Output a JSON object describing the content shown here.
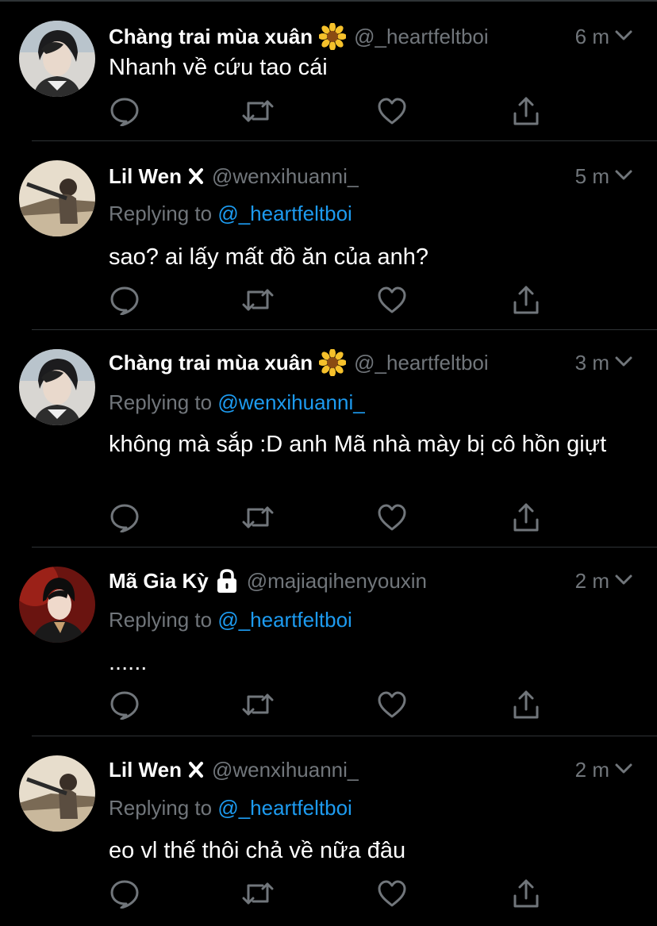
{
  "theme": {
    "background": "#000000",
    "text": "#ffffff",
    "muted": "#71767b",
    "accent": "#1d9bf0",
    "divider": "#2f3336"
  },
  "tweets": [
    {
      "name": "Chàng trai mùa xuân",
      "badge_icon": "sunflower-icon",
      "handle": "@_heartfeltboi",
      "time": "6 m",
      "reply_prefix": "",
      "reply_to": "",
      "text": "Nhanh về cứu tao cái"
    },
    {
      "name": "Lil Wen",
      "badge_icon": "x-mark-icon",
      "handle": "@wenxihuanni_",
      "time": "5 m",
      "reply_prefix": "Replying to ",
      "reply_to": "@_heartfeltboi",
      "text": "sao? ai lấy mất đồ ăn của anh?"
    },
    {
      "name": "Chàng trai mùa xuân",
      "badge_icon": "sunflower-icon",
      "handle": "@_heartfeltboi",
      "time": "3 m",
      "reply_prefix": "Replying to ",
      "reply_to": "@wenxihuanni_",
      "text": "không mà sắp :D anh Mã nhà mày bị cô hồn giựt"
    },
    {
      "name": "Mã Gia Kỳ",
      "badge_icon": "lock-icon",
      "handle": "@majiaqihenyouxin",
      "time": "2 m",
      "reply_prefix": "Replying to ",
      "reply_to": "@_heartfeltboi",
      "text": "......"
    },
    {
      "name": "Lil Wen",
      "badge_icon": "x-mark-icon",
      "handle": "@wenxihuanni_",
      "time": "2 m",
      "reply_prefix": "Replying to ",
      "reply_to": "@_heartfeltboi",
      "text": "eo vl thế thôi chả về nữa đâu"
    }
  ]
}
